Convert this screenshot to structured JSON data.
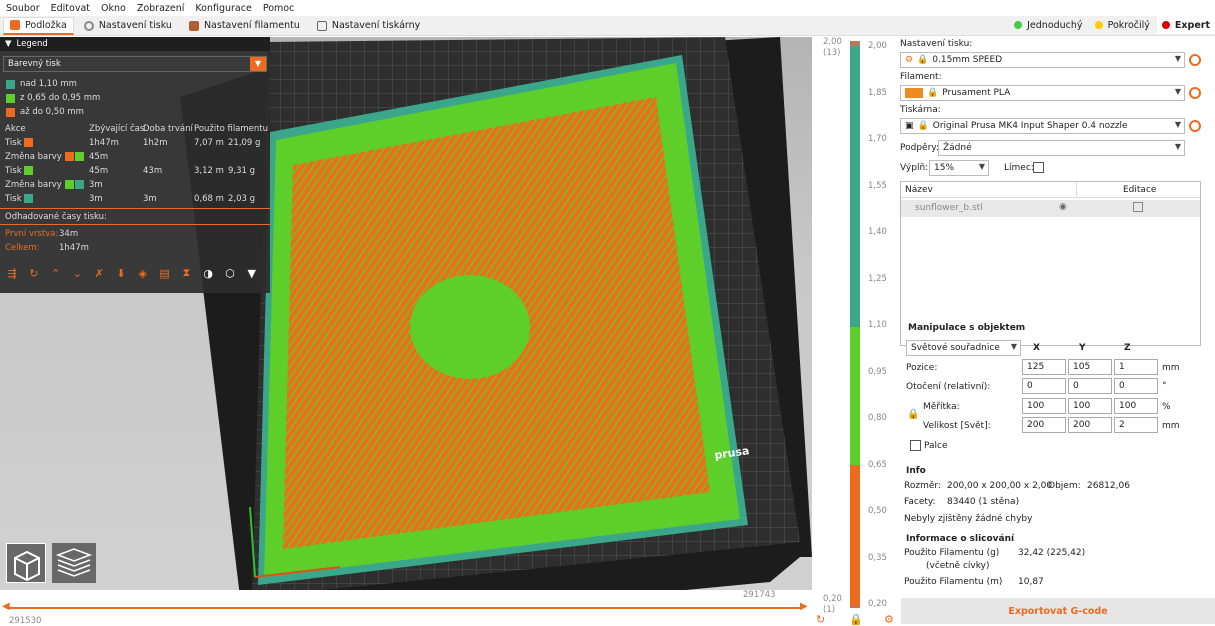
{
  "menu": [
    "Soubor",
    "Editovat",
    "Okno",
    "Zobrazení",
    "Konfigurace",
    "Pomoc"
  ],
  "tabs": [
    {
      "label": "Podložka"
    },
    {
      "label": "Nastavení tisku"
    },
    {
      "label": "Nastavení filamentu"
    },
    {
      "label": "Nastavení tiskárny"
    }
  ],
  "modes": [
    {
      "label": "Jednoduchý",
      "color": "#44cc44"
    },
    {
      "label": "Pokročilý",
      "color": "#ffcc00"
    },
    {
      "label": "Expert",
      "color": "#dd0000"
    }
  ],
  "legend": {
    "title": "Legend",
    "view_type": "Barevný tisk",
    "ranges": [
      {
        "label": "nad 1,10 mm",
        "color": "#3aa68a"
      },
      {
        "label": "z 0,65 do 0,95 mm",
        "color": "#5dce2a"
      },
      {
        "label": "až do 0,50 mm",
        "color": "#ed6b21"
      }
    ],
    "headers": [
      "Akce",
      "Zbývající čas",
      "Doba trvání",
      "Použito filamentu"
    ],
    "rows": [
      {
        "action": "Tisk",
        "remaining": "1h47m",
        "duration": "1h2m",
        "length": "7,07 m",
        "weight": "21,09 g"
      },
      {
        "action": "Změna barvy",
        "remaining": "45m",
        "duration": "",
        "length": "",
        "weight": ""
      },
      {
        "action": "Tisk",
        "remaining": "45m",
        "duration": "43m",
        "length": "3,12 m",
        "weight": "9,31 g"
      },
      {
        "action": "Změna barvy",
        "remaining": "3m",
        "duration": "",
        "length": "",
        "weight": ""
      },
      {
        "action": "Tisk",
        "remaining": "3m",
        "duration": "3m",
        "length": "0,68 m",
        "weight": "2,03 g"
      }
    ],
    "estimated_label": "Odhadované časy tisku:",
    "first_layer_label": "První vrstva:",
    "first_layer": "34m",
    "total_label": "Celkem:",
    "total": "1h47m"
  },
  "slider": {
    "top": "2,00",
    "top_sub": "(13)",
    "bottom": "0,20",
    "bottom_sub": "(1)",
    "ticks": [
      "2,00",
      "1,85",
      "1,70",
      "1,55",
      "1,40",
      "1,25",
      "1,10",
      "0,95",
      "0,80",
      "0,65",
      "0,50",
      "0,35",
      "0,20"
    ]
  },
  "hslider": {
    "left": "291530",
    "right": "291743"
  },
  "bed_brand": "prusa",
  "right": {
    "print_settings_label": "Nastavení tisku:",
    "print_settings": "0.15mm SPEED",
    "filament_label": "Filament:",
    "filament": "Prusament PLA",
    "filament_color": "#ed8a21",
    "printer_label": "Tiskárna:",
    "printer": "Original Prusa MK4 Input Shaper 0.4 nozzle",
    "supports_label": "Podpěry:",
    "supports": "Žádné",
    "infill_label": "Výplň:",
    "infill": "15%",
    "brim_label": "Límec:",
    "list_headers": [
      "Název",
      "Editace"
    ],
    "object": "sunflower_b.stl",
    "manip_title": "Manipulace s objektem",
    "coords": "Světové souřadnice",
    "axes": [
      "X",
      "Y",
      "Z"
    ],
    "position_label": "Pozice:",
    "position": [
      "125",
      "105",
      "1"
    ],
    "position_unit": "mm",
    "rotation_label": "Otočení (relativní):",
    "rotation": [
      "0",
      "0",
      "0"
    ],
    "rotation_unit": "°",
    "scale_label": "Měřítka:",
    "scale": [
      "100",
      "100",
      "100"
    ],
    "scale_unit": "%",
    "size_label": "Velikost [Svět]:",
    "size": [
      "200",
      "200",
      "2"
    ],
    "size_unit": "mm",
    "inches_label": "Palce",
    "info_title": "Info",
    "size_info_label": "Rozměr:",
    "size_info": "200,00 x 200,00 x 2,00",
    "volume_label": "Objem:",
    "volume": "26812,06",
    "facets_label": "Facety:",
    "facets": "83440 (1 stěna)",
    "errors": "Nebyly zjištěny žádné chyby",
    "slice_title": "Informace o slicování",
    "fil_g_label": "Použito Filamentu (g)",
    "fil_g_sub": "(včetně cívky)",
    "fil_g": "32,42 (225,42)",
    "fil_m_label": "Použito Filamentu (m)",
    "fil_m": "10,87",
    "export": "Exportovat G-code"
  }
}
